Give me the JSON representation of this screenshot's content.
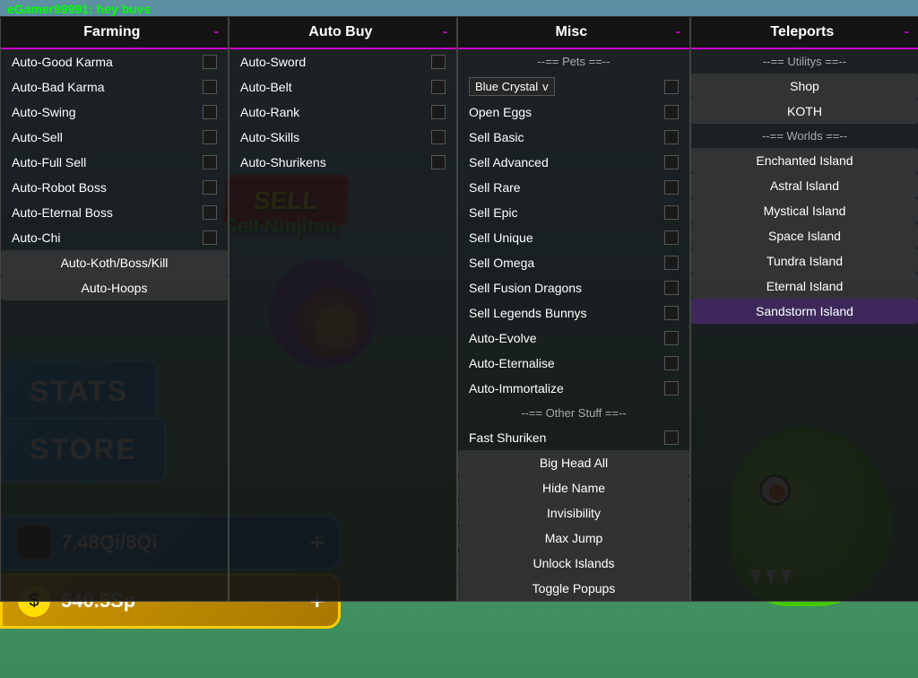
{
  "username": "eGamer99991: hey buvs",
  "farming_panel": {
    "title": "Farming",
    "close": "-",
    "items": [
      {
        "label": "Auto-Good Karma",
        "type": "checkbox",
        "checked": false
      },
      {
        "label": "Auto-Bad Karma",
        "type": "checkbox",
        "checked": false
      },
      {
        "label": "Auto-Swing",
        "type": "checkbox",
        "checked": false
      },
      {
        "label": "Auto-Sell",
        "type": "checkbox",
        "checked": false
      },
      {
        "label": "Auto-Full Sell",
        "type": "checkbox",
        "checked": false
      },
      {
        "label": "Auto-Robot Boss",
        "type": "checkbox",
        "checked": false
      },
      {
        "label": "Auto-Eternal Boss",
        "type": "checkbox",
        "checked": false
      },
      {
        "label": "Auto-Chi",
        "type": "checkbox",
        "checked": false
      },
      {
        "label": "Auto-Koth/Boss/Kill",
        "type": "highlight"
      },
      {
        "label": "Auto-Hoops",
        "type": "highlight"
      }
    ]
  },
  "auto_buy_panel": {
    "title": "Auto Buy",
    "close": "-",
    "items": [
      {
        "label": "Auto-Sword",
        "type": "checkbox",
        "checked": false
      },
      {
        "label": "Auto-Belt",
        "type": "checkbox",
        "checked": false
      },
      {
        "label": "Auto-Rank",
        "type": "checkbox",
        "checked": false
      },
      {
        "label": "Auto-Skills",
        "type": "checkbox",
        "checked": false
      },
      {
        "label": "Auto-Shurikens",
        "type": "checkbox",
        "checked": false
      }
    ]
  },
  "misc_panel": {
    "title": "Misc",
    "close": "-",
    "pets_header": "--== Pets ==--",
    "pet_dropdown": {
      "label": "Blue Crystal",
      "indicator": "v"
    },
    "items": [
      {
        "label": "Open Eggs",
        "type": "checkbox",
        "checked": false
      },
      {
        "label": "Sell Basic",
        "type": "checkbox",
        "checked": false
      },
      {
        "label": "Sell Advanced",
        "type": "checkbox",
        "checked": false
      },
      {
        "label": "Sell Rare",
        "type": "checkbox",
        "checked": false
      },
      {
        "label": "Sell Epic",
        "type": "checkbox",
        "checked": false
      },
      {
        "label": "Sell Unique",
        "type": "checkbox",
        "checked": false
      },
      {
        "label": "Sell Omega",
        "type": "checkbox",
        "checked": false
      },
      {
        "label": "Sell Fusion Dragons",
        "type": "checkbox",
        "checked": false
      },
      {
        "label": "Sell Legends Bunnys",
        "type": "checkbox",
        "checked": false
      },
      {
        "label": "Auto-Evolve",
        "type": "checkbox",
        "checked": false
      },
      {
        "label": "Auto-Eternalise",
        "type": "checkbox",
        "checked": false
      },
      {
        "label": "Auto-Immortalize",
        "type": "checkbox",
        "checked": false
      }
    ],
    "other_header": "--== Other Stuff ==--",
    "other_items": [
      {
        "label": "Fast Shuriken",
        "type": "checkbox",
        "checked": false
      },
      {
        "label": "Big Head All",
        "type": "highlight"
      },
      {
        "label": "Hide Name",
        "type": "highlight"
      },
      {
        "label": "Invisibility",
        "type": "highlight"
      },
      {
        "label": "Max Jump",
        "type": "highlight"
      },
      {
        "label": "Unlock Islands",
        "type": "highlight"
      },
      {
        "label": "Toggle Popups",
        "type": "highlight"
      }
    ]
  },
  "teleports_panel": {
    "title": "Teleports",
    "close": "-",
    "utils_header": "--== Utilitys ==--",
    "util_items": [
      {
        "label": "Shop",
        "type": "highlight"
      },
      {
        "label": "KOTH",
        "type": "highlight"
      }
    ],
    "worlds_header": "--== Worlds ==--",
    "world_items": [
      {
        "label": "Enchanted Island",
        "type": "highlight"
      },
      {
        "label": "Astral Island",
        "type": "highlight"
      },
      {
        "label": "Mystical Island",
        "type": "highlight"
      },
      {
        "label": "Space Island",
        "type": "highlight"
      },
      {
        "label": "Tundra Island",
        "type": "highlight"
      },
      {
        "label": "Eternal Island",
        "type": "highlight"
      },
      {
        "label": "Sandstorm Island",
        "type": "highlight",
        "selected": true
      }
    ]
  },
  "ui": {
    "stats_label": "STATS",
    "store_label": "STORE",
    "xp_current": "7.48Qi",
    "xp_max": "8Qi",
    "xp_separator": "/",
    "xp_display": "7.48Qi/8Qi",
    "currency_display": "540.5Sp",
    "plus_label": "+",
    "sell_label": "SELL",
    "sell_ninjitsu_label": "Sell Ninjitsu"
  }
}
